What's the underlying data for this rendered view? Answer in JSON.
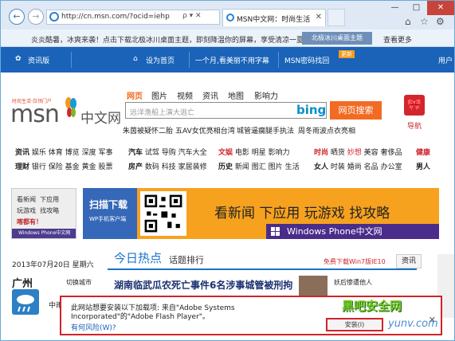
{
  "browser": {
    "url": "http://cn.msn.com/?ocid=iehp",
    "url_controls": "ρ ▾ ✕",
    "tab_title": "MSN中文网：时尚生活 白...",
    "window_controls": [
      "—",
      "□",
      "✕"
    ],
    "tool_icons": [
      "⌂",
      "☆",
      "⚙"
    ]
  },
  "promo_strip": {
    "text": "炎炎酷暑，冰爽来袭！点击下载北极冰川桌面主题，即刻降温你的屏幕，享受清凉一夏！",
    "button": "北极冰川桌面主题",
    "more": "查看更多"
  },
  "topnav": {
    "items": [
      "资讯版",
      "设为首页",
      "一个月,看美丽不用字幕",
      "MSN密码找回",
      "用户"
    ],
    "badge": "更新"
  },
  "search": {
    "tabs": [
      "网页",
      "图片",
      "视频",
      "资讯",
      "地图",
      "影响力"
    ],
    "placeholder": "远洋渔船上演大逃亡",
    "bing": "bing",
    "button": "网页搜索",
    "hot_links": [
      "朱茵被疑怀二胎",
      "五AV女优亮相台湾",
      "城管逼瘸腿手执法",
      "周冬雨波点衣亮相"
    ],
    "nav_label": "导航"
  },
  "logo": {
    "tagline": "时尚生活·白领门户",
    "msn": "msn",
    "cn": "中文网"
  },
  "categories": {
    "row1_a": [
      "资讯",
      "娱乐",
      "体育",
      "博览",
      "深度",
      "军事"
    ],
    "row2_a": [
      "理财",
      "银行",
      "保险",
      "基金",
      "黄金",
      "股票"
    ],
    "row1_b": [
      "汽车",
      "试驾",
      "导购",
      "汽车大全"
    ],
    "row2_b": [
      "房产",
      "数码",
      "科技",
      "家居装修"
    ],
    "row1_c": [
      "文娱",
      "电影",
      "明星",
      "影响力"
    ],
    "row2_c": [
      "历史",
      "新闻",
      "图汇",
      "图片",
      "生活"
    ],
    "row1_d": [
      "时尚",
      "晒货",
      "妙想",
      "美容",
      "奢侈品"
    ],
    "row2_d": [
      "女人",
      "时装",
      "婚尚",
      "名品",
      "办公室"
    ],
    "row1_e": "健康",
    "row2_e": "男人"
  },
  "banner1": {
    "lines": [
      [
        "看新闻",
        "下应用"
      ],
      [
        "玩游戏",
        "找攻略"
      ],
      [
        "喀都有！",
        ""
      ]
    ],
    "footer": "Windows Phone中文网"
  },
  "banner2": {
    "scan": "扫描下载",
    "client": "WP手机客户端",
    "headline": "看新闻  下应用  玩游戏  找攻略",
    "brand": "Windows Phone中文网"
  },
  "left": {
    "date": "2013年07月20日 星期六",
    "city": "广州",
    "switch": "切换城市",
    "weather_cut": "中雨"
  },
  "main": {
    "hot_title": "今日热点",
    "hot_sub": "话题排行",
    "win_promo": "免费下载Win7版IE10",
    "tab": "资讯",
    "headline": "湖南临武瓜农死亡事件6名涉事城管被刑拘",
    "side": "妖后惨遭他人"
  },
  "infobar": {
    "message": "此网站想要安装以下加载项: 来自\"Adobe Systems Incorporated\"的\"Adobe Flash Player\"。",
    "risk_link": "有何风险(W)?",
    "allow": "安装(I)",
    "close": "✕"
  },
  "watermark": {
    "site": "黑吧安全网",
    "domain": "yunv.com"
  }
}
